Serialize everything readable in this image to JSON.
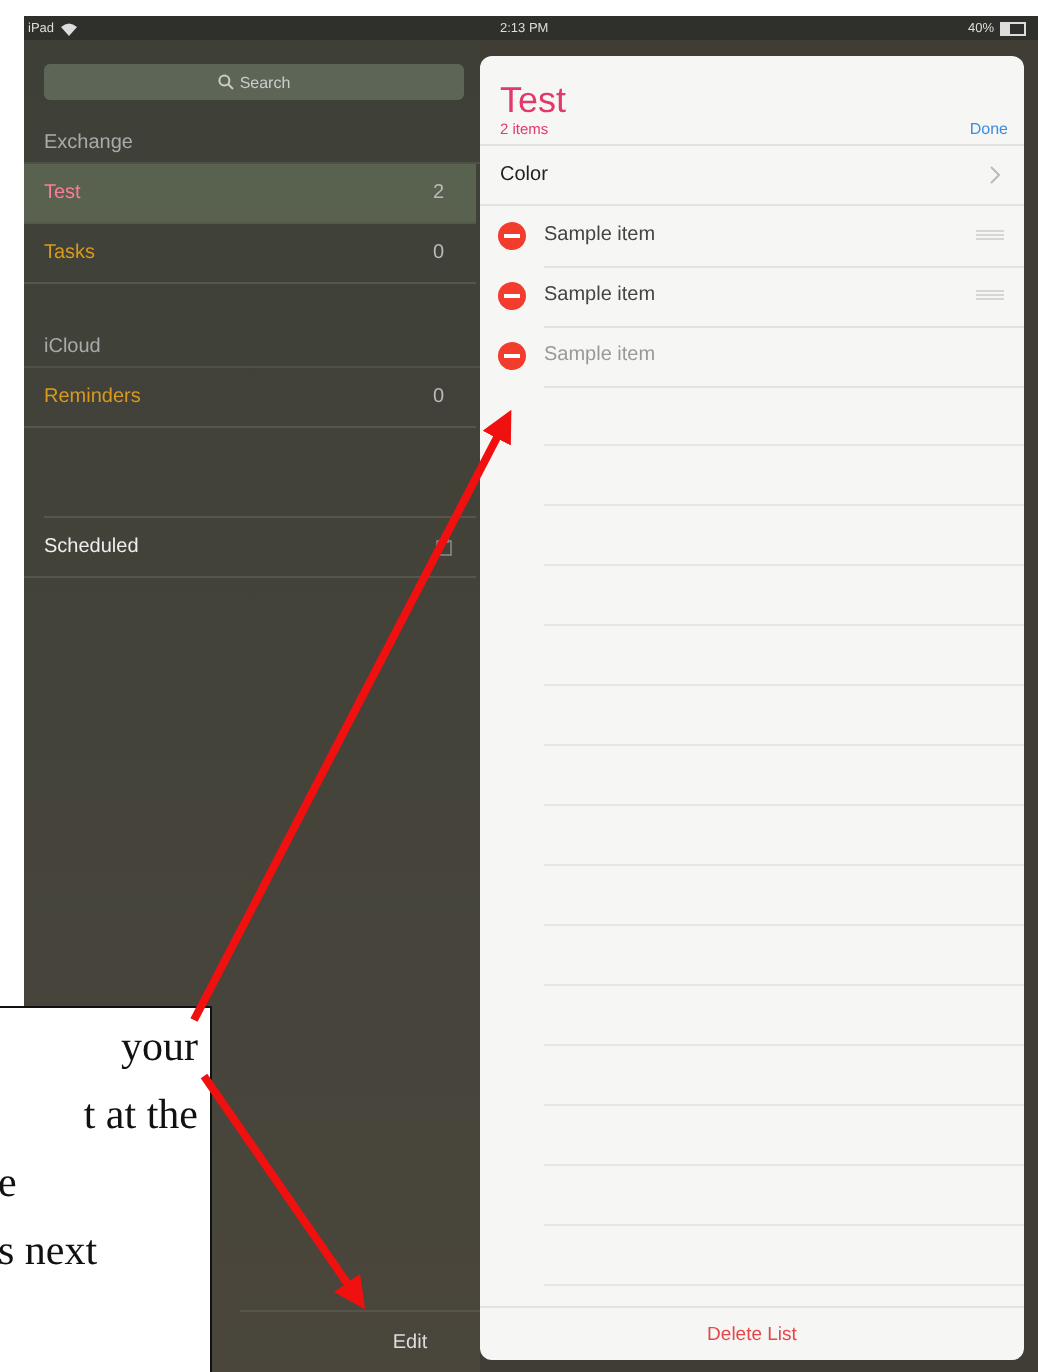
{
  "status_bar": {
    "device": "iPad",
    "time": "2:13 PM",
    "battery": "40%"
  },
  "sidebar": {
    "search": {
      "placeholder": "Search"
    },
    "sections": [
      {
        "title": "Exchange",
        "lists": [
          {
            "name": "Test",
            "count": "2",
            "color": "#ff7a9c",
            "selected": true
          },
          {
            "name": "Tasks",
            "count": "0",
            "color": "#d99a1c",
            "selected": false
          }
        ]
      },
      {
        "title": "iCloud",
        "lists": [
          {
            "name": "Reminders",
            "count": "0",
            "color": "#d99a1c",
            "selected": false
          }
        ]
      }
    ],
    "scheduled": {
      "name": "Scheduled"
    },
    "edit_button": "Edit"
  },
  "list": {
    "title": "Test",
    "subtitle": "2 items",
    "done_button": "Done",
    "color_row": "Color",
    "items": [
      {
        "text": "Sample item",
        "dimmed": false,
        "handle": true
      },
      {
        "text": "Sample item",
        "dimmed": false,
        "handle": true
      },
      {
        "text": "Sample item",
        "dimmed": true,
        "handle": false
      }
    ],
    "delete_button": "Delete List"
  },
  "callout": {
    "lines": [
      "your",
      "t at the",
      "e",
      "s next"
    ]
  }
}
